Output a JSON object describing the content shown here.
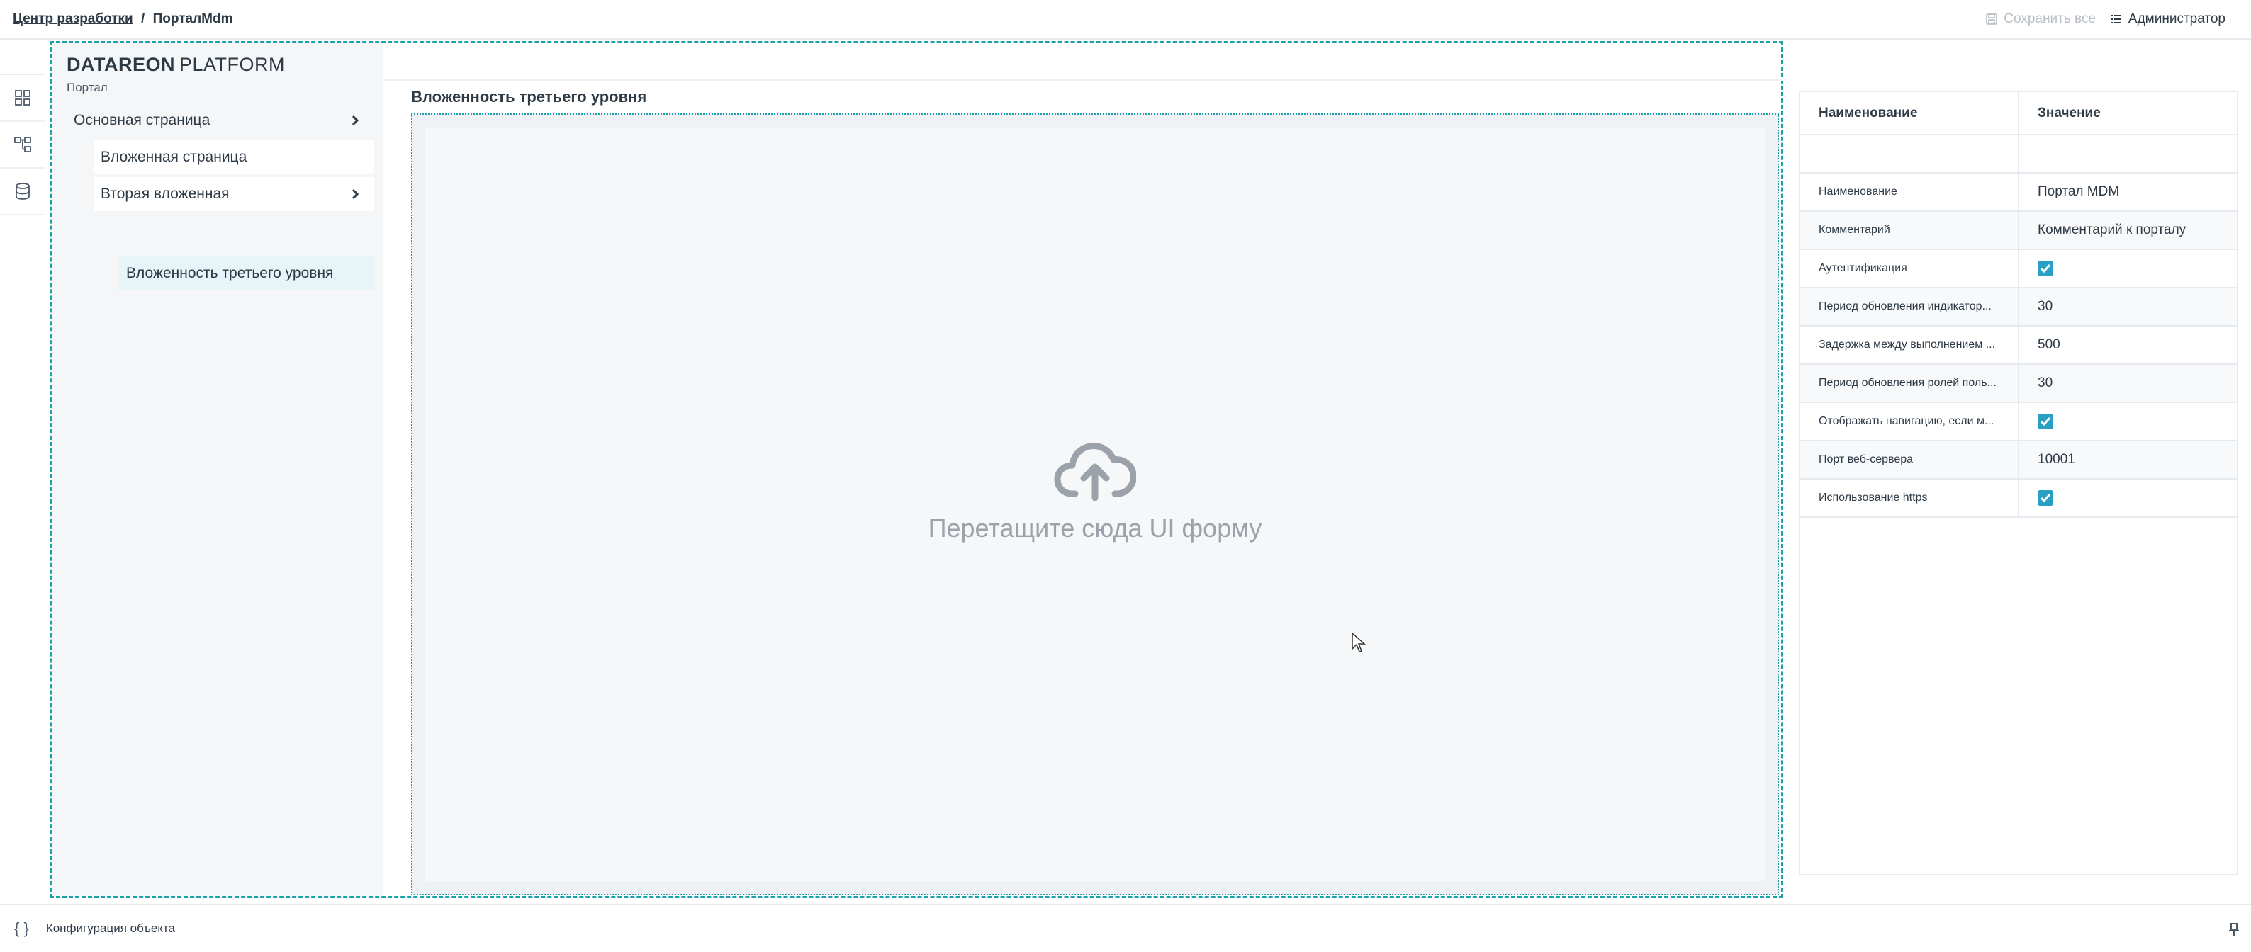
{
  "breadcrumb": {
    "root": "Центр разработки",
    "separator": "/",
    "current": "ПорталMdm"
  },
  "top_actions": {
    "save_all": "Сохранить все",
    "admin": "Администратор"
  },
  "icons": {
    "save": "save-icon",
    "admin": "list-icon",
    "sidebar": [
      "dashboard-icon",
      "hierarchy-icon",
      "database-icon"
    ],
    "upload": "cloud-upload-icon",
    "config": "braces-icon",
    "pin": "pin-icon"
  },
  "logo": {
    "bold": "DATAREON",
    "light": "PLATFORM",
    "subtitle": "Портал"
  },
  "nav": {
    "main": "Основная страница",
    "nested": "Вложенная страница",
    "second_nested": "Вторая вложенная",
    "third_level": "Вложенность третьего уровня"
  },
  "content": {
    "title": "Вложенность третьего уровня",
    "drop_text": "Перетащите сюда UI форму"
  },
  "props": {
    "header_name": "Наименование",
    "header_value": "Значение",
    "rows": [
      {
        "name": "Наименование",
        "value": "Портал MDM"
      },
      {
        "name": "Комментарий",
        "value": "Комментарий к порталу"
      },
      {
        "name": "Аутентификация",
        "checked": true
      },
      {
        "name": "Период обновления индикатор...",
        "value": "30"
      },
      {
        "name": "Задержка между выполнением ...",
        "value": "500"
      },
      {
        "name": "Период обновления ролей поль...",
        "value": "30"
      },
      {
        "name": "Отображать навигацию, если м...",
        "checked": true
      },
      {
        "name": "Порт веб-сервера",
        "value": "10001"
      },
      {
        "name": "Использование https",
        "checked": true
      }
    ]
  },
  "bottom": {
    "config_label": "Конфигурация объекта"
  },
  "colors": {
    "accent": "#1aa1a9",
    "checkbox": "#2a9fc4",
    "text": "#2e3a46"
  }
}
